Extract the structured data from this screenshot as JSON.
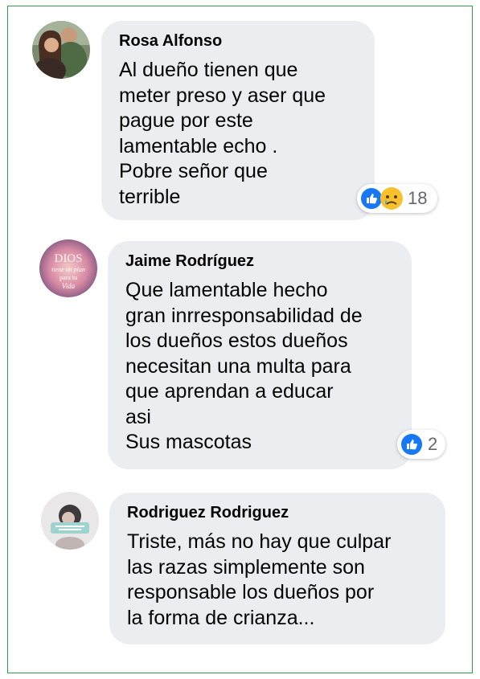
{
  "comments": [
    {
      "author": "Rosa Alfonso",
      "text": "Al dueño tienen que\nmeter preso y aser que\npague por este\nlamentable echo .\nPobre señor que\nterrible",
      "reactions": {
        "icons": [
          "like-icon",
          "sad-icon"
        ],
        "count": "18"
      }
    },
    {
      "author": "Jaime Rodríguez",
      "text": "Que lamentable hecho\ngran inrresponsabilidad de\nlos dueños estos dueños\nnecesitan una multa para\nque aprendan a educar\nasi\nSus mascotas",
      "avatar_text": [
        "DIOS",
        "tiene un plan",
        "para tu",
        "Vida"
      ],
      "reactions": {
        "icons": [
          "like-icon"
        ],
        "count": "2"
      }
    },
    {
      "author": "Rodriguez Rodriguez",
      "text": "Triste, más no hay que culpar\nlas razas simplemente son\nresponsable los dueños por\nla forma de crianza..."
    }
  ],
  "colors": {
    "bubble": "#ebedf0",
    "like": "#1877f2",
    "frame_border": "#2e9e47",
    "count_text": "#65676b"
  }
}
